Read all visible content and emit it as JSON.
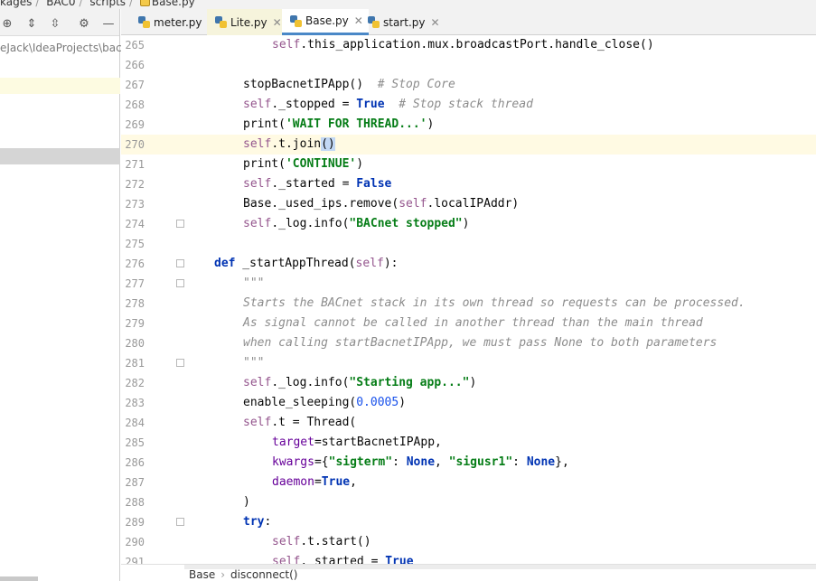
{
  "breadcrumb": {
    "items": [
      "kages",
      "BAC0",
      "scripts",
      "Base.py"
    ]
  },
  "project_panel": {
    "path_text": "eJack\\IdeaProjects\\bacne",
    "toolbar_icons": [
      "target-icon",
      "expand-all-icon",
      "collapse-all-icon",
      "gear-icon",
      "minimize-icon"
    ]
  },
  "tabs": [
    {
      "label": "meter.py",
      "active": false
    },
    {
      "label": "Lite.py",
      "active": false
    },
    {
      "label": "Base.py",
      "active": true
    },
    {
      "label": "start.py",
      "active": false
    }
  ],
  "editor": {
    "current_line": 270,
    "lines": [
      {
        "no": "265",
        "indent": 3,
        "tokens": [
          [
            "sf",
            "self"
          ],
          [
            "",
            "."
          ],
          [
            "",
            "this_application.mux.broadcastPort.handle_close()"
          ]
        ]
      },
      {
        "no": "266",
        "indent": 0,
        "tokens": []
      },
      {
        "no": "267",
        "indent": 2,
        "tokens": [
          [
            "",
            "stopBacnetIPApp()  "
          ],
          [
            "c",
            "# Stop Core"
          ]
        ]
      },
      {
        "no": "268",
        "indent": 2,
        "tokens": [
          [
            "sf",
            "self"
          ],
          [
            "",
            "._stopped = "
          ],
          [
            "k",
            "True"
          ],
          [
            "",
            "  "
          ],
          [
            "c",
            "# Stop stack thread"
          ]
        ]
      },
      {
        "no": "269",
        "indent": 2,
        "tokens": [
          [
            "",
            "print("
          ],
          [
            "s",
            "'WAIT FOR THREAD...'"
          ],
          [
            "",
            ")"
          ]
        ]
      },
      {
        "no": "270",
        "indent": 2,
        "tokens": [
          [
            "sf",
            "self"
          ],
          [
            "",
            ".t.join"
          ],
          [
            "caret",
            "()"
          ]
        ]
      },
      {
        "no": "271",
        "indent": 2,
        "tokens": [
          [
            "",
            "print("
          ],
          [
            "s",
            "'CONTINUE'"
          ],
          [
            "",
            ")"
          ]
        ]
      },
      {
        "no": "272",
        "indent": 2,
        "tokens": [
          [
            "sf",
            "self"
          ],
          [
            "",
            "._started = "
          ],
          [
            "k",
            "False"
          ]
        ]
      },
      {
        "no": "273",
        "indent": 2,
        "tokens": [
          [
            "",
            "Base._used_ips.remove("
          ],
          [
            "sf",
            "self"
          ],
          [
            "",
            ".localIPAddr)"
          ]
        ]
      },
      {
        "no": "274",
        "indent": 2,
        "tokens": [
          [
            "sf",
            "self"
          ],
          [
            "",
            "._log.info("
          ],
          [
            "s",
            "\"BACnet stopped\""
          ],
          [
            "",
            ")"
          ]
        ]
      },
      {
        "no": "275",
        "indent": 0,
        "tokens": []
      },
      {
        "no": "276",
        "indent": 1,
        "tokens": [
          [
            "k",
            "def"
          ],
          [
            "",
            " _startAppThread("
          ],
          [
            "sf",
            "self"
          ],
          [
            "",
            "):"
          ]
        ]
      },
      {
        "no": "277",
        "indent": 2,
        "tokens": [
          [
            "d",
            "\"\"\""
          ]
        ]
      },
      {
        "no": "278",
        "indent": 2,
        "tokens": [
          [
            "d",
            "Starts the BACnet stack in its own thread so requests can be processed."
          ]
        ]
      },
      {
        "no": "279",
        "indent": 2,
        "tokens": [
          [
            "d",
            "As signal cannot be called in another thread than the main thread"
          ]
        ]
      },
      {
        "no": "280",
        "indent": 2,
        "tokens": [
          [
            "d",
            "when calling startBacnetIPApp, we must pass None to both parameters"
          ]
        ]
      },
      {
        "no": "281",
        "indent": 2,
        "tokens": [
          [
            "d",
            "\"\"\""
          ]
        ]
      },
      {
        "no": "282",
        "indent": 2,
        "tokens": [
          [
            "sf",
            "self"
          ],
          [
            "",
            "._log.info("
          ],
          [
            "s",
            "\"Starting app...\""
          ],
          [
            "",
            ")"
          ]
        ]
      },
      {
        "no": "283",
        "indent": 2,
        "tokens": [
          [
            "",
            "enable_sleeping("
          ],
          [
            "n",
            "0.0005"
          ],
          [
            "",
            ")"
          ]
        ]
      },
      {
        "no": "284",
        "indent": 2,
        "tokens": [
          [
            "sf",
            "self"
          ],
          [
            "",
            ".t = Thread("
          ]
        ]
      },
      {
        "no": "285",
        "indent": 3,
        "tokens": [
          [
            "kw",
            "target"
          ],
          [
            "",
            "=startBacnetIPApp,"
          ]
        ]
      },
      {
        "no": "286",
        "indent": 3,
        "tokens": [
          [
            "kw",
            "kwargs"
          ],
          [
            "",
            "={"
          ],
          [
            "s",
            "\"sigterm\""
          ],
          [
            "",
            ": "
          ],
          [
            "k",
            "None"
          ],
          [
            "",
            ", "
          ],
          [
            "s",
            "\"sigusr1\""
          ],
          [
            "",
            ": "
          ],
          [
            "k",
            "None"
          ],
          [
            "",
            "},"
          ]
        ]
      },
      {
        "no": "287",
        "indent": 3,
        "tokens": [
          [
            "kw",
            "daemon"
          ],
          [
            "",
            "="
          ],
          [
            "k",
            "True"
          ],
          [
            "",
            ","
          ]
        ]
      },
      {
        "no": "288",
        "indent": 2,
        "tokens": [
          [
            "",
            ")"
          ]
        ]
      },
      {
        "no": "289",
        "indent": 2,
        "tokens": [
          [
            "k",
            "try"
          ],
          [
            "",
            ":"
          ]
        ]
      },
      {
        "no": "290",
        "indent": 3,
        "tokens": [
          [
            "sf",
            "self"
          ],
          [
            "",
            ".t.start()"
          ]
        ]
      },
      {
        "no": "291",
        "indent": 3,
        "tokens": [
          [
            "sf",
            "self"
          ],
          [
            "",
            "._started = "
          ],
          [
            "k",
            "True"
          ]
        ]
      }
    ],
    "fold_markers": [
      "274",
      "276",
      "277",
      "281",
      "289"
    ]
  },
  "status_breadcrumb": {
    "items": [
      "Base",
      "disconnect()"
    ]
  }
}
